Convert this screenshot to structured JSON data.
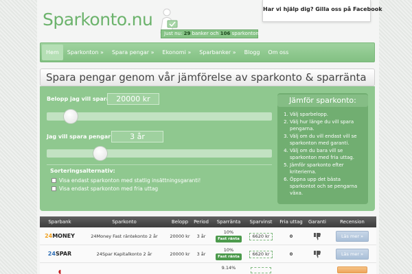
{
  "header": {
    "logo_text": "Sparkonto.nu",
    "tagline_prefix": "Just nu:",
    "tagline_banks": "29",
    "tagline_mid": "banker och",
    "tagline_accounts": "106",
    "tagline_suffix": "sparkonton.",
    "facebook_text": "Har vi hjälp dig? Gilla oss på Facebook"
  },
  "nav": {
    "items": [
      {
        "label": "Hem"
      },
      {
        "label": "Sparkonton »"
      },
      {
        "label": "Spara pengar »"
      },
      {
        "label": "Ekonomi »"
      },
      {
        "label": "Sparbanker »"
      },
      {
        "label": "Blogg"
      },
      {
        "label": "Om oss"
      }
    ]
  },
  "hero": {
    "title": "Spara pengar genom vår jämförelse av sparkonto & sparränta"
  },
  "calculator": {
    "amount_label": "Belopp jag vill spara:",
    "amount_value": "20000 kr",
    "amount_slider_fraction": 0.08,
    "years_label": "Jag vill spara pengar i:",
    "years_value": "3 år",
    "years_slider_fraction": 0.22,
    "sort_title": "Sorteringsalternativ:",
    "sort_option_1": "Visa endast sparkonton med statlig insättningsgaranti!",
    "sort_option_2": "Visa endast sparkonton med fria uttag"
  },
  "compare": {
    "title": "Jämför sparkonto:",
    "steps": [
      "Välj sparbelopp.",
      "Välj hur länge du vill spara pengarna.",
      "Välj om du vill endast vill se sparkonton med garanti.",
      "Välj om du bara vill se sparkonton med fria uttag.",
      "Jämför sparkonto efter kriterierna.",
      "Öppna upp det bästa sparkontot och se pengarna växa."
    ]
  },
  "table": {
    "headers": [
      "Sparbank",
      "Sparkonto",
      "Belopp",
      "Period",
      "Sparränta",
      "Sparvinst",
      "Fria uttag",
      "Garanti",
      "Recension"
    ],
    "rows": [
      {
        "bank_logo_a": "24",
        "bank_logo_b": "MONEY",
        "account": "24Money Fast räntekonto 2 år",
        "amount": "20000 kr",
        "period": "3 år",
        "rate": "10%",
        "rate_badge": "Fast ränta",
        "win": "6620 kr",
        "withdrawals": "0",
        "button": "Läs mer »"
      },
      {
        "bank_logo_a": "24",
        "bank_logo_b": "SPAR",
        "account": "24Spar Kapitalkonto 2 år",
        "amount": "20000 kr",
        "period": "3 år",
        "rate": "10%",
        "rate_badge": "Fast ränta",
        "win": "6620 kr",
        "withdrawals": "0",
        "button": "Läs mer »"
      },
      {
        "bank_logo_a": "",
        "bank_logo_b": "",
        "account": "",
        "amount": "",
        "period": "",
        "rate": "9.14%",
        "rate_badge": "",
        "win": "",
        "withdrawals": "",
        "button": ""
      }
    ]
  },
  "colors": {
    "brand_green": "#8fc88f",
    "nav_green": "#82c082",
    "header_dark": "#3c3c3c"
  }
}
